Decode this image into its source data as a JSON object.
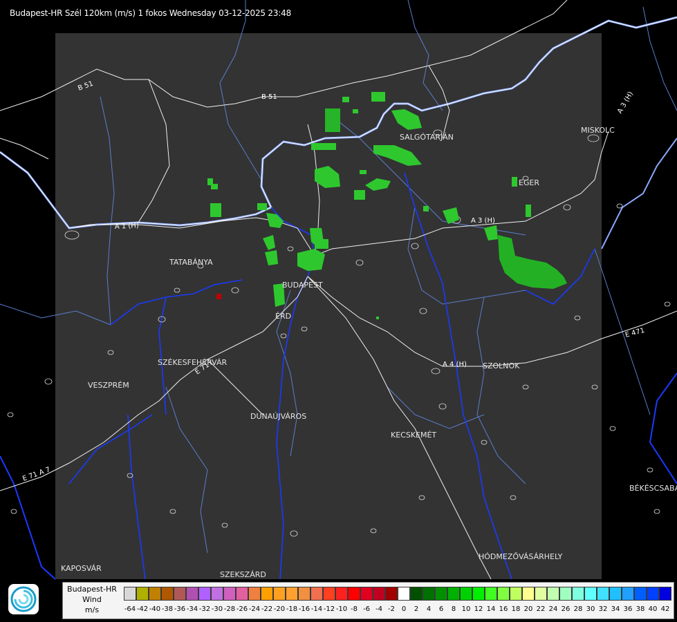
{
  "title": "Budapest-HR Szél 120km (m/s) 1 fokos Wednesday 03-12-2025 23:48",
  "cities": [
    {
      "id": "salgotarjan",
      "name": "SALGÓTARJÁN"
    },
    {
      "id": "miskolc",
      "name": "MISKOLC"
    },
    {
      "id": "eger",
      "name": "EGER"
    },
    {
      "id": "tatabanya",
      "name": "TATABÁNYA"
    },
    {
      "id": "budapest",
      "name": "BUDAPEST"
    },
    {
      "id": "erd",
      "name": "ÉRD"
    },
    {
      "id": "szekesfehervar",
      "name": "SZÉKESFEHÉRVÁR"
    },
    {
      "id": "veszprem",
      "name": "VESZPRÉM"
    },
    {
      "id": "dunaujvaros",
      "name": "DUNAÚJVÁROS"
    },
    {
      "id": "kecskemet",
      "name": "KECSKEMÉT"
    },
    {
      "id": "szolnok",
      "name": "SZOLNOK"
    },
    {
      "id": "bekescsaba",
      "name": "BÉKÉSCSABA"
    },
    {
      "id": "hodmezovasarhely",
      "name": "HÓDMEZŐVÁSÁRHELY"
    },
    {
      "id": "kaposvar",
      "name": "KAPOSVÁR"
    },
    {
      "id": "szekszard",
      "name": "SZEKSZÁRD"
    }
  ],
  "roads": [
    {
      "id": "b51-west",
      "name": "B 51"
    },
    {
      "id": "b51-east",
      "name": "B 51"
    },
    {
      "id": "a3-north",
      "name": "A 3 (H)"
    },
    {
      "id": "a3-mid",
      "name": "A 3 (H)"
    },
    {
      "id": "a1",
      "name": "A 1 (H)"
    },
    {
      "id": "a4",
      "name": "A 4 (H)"
    },
    {
      "id": "e71",
      "name": "E 71"
    },
    {
      "id": "e471",
      "name": "E 471"
    },
    {
      "id": "a1-south",
      "name": "E 71 A 7"
    }
  ],
  "legend": {
    "title_line1": "Budapest-HR",
    "title_line2": "Wind",
    "title_line3": "m/s",
    "scale": [
      {
        "value": "-64",
        "color": "#d8d8d8"
      },
      {
        "value": "-42",
        "color": "#b0b000"
      },
      {
        "value": "-40",
        "color": "#c08000"
      },
      {
        "value": "-38",
        "color": "#b05800"
      },
      {
        "value": "-36",
        "color": "#b05858"
      },
      {
        "value": "-34",
        "color": "#b050b0"
      },
      {
        "value": "-32",
        "color": "#b060ff"
      },
      {
        "value": "-30",
        "color": "#c070e0"
      },
      {
        "value": "-28",
        "color": "#d060c0"
      },
      {
        "value": "-26",
        "color": "#e060a0"
      },
      {
        "value": "-24",
        "color": "#f08040"
      },
      {
        "value": "-22",
        "color": "#ffa000"
      },
      {
        "value": "-20",
        "color": "#ffa020"
      },
      {
        "value": "-18",
        "color": "#ffa030"
      },
      {
        "value": "-16",
        "color": "#f09040"
      },
      {
        "value": "-14",
        "color": "#f07050"
      },
      {
        "value": "-12",
        "color": "#ff4020"
      },
      {
        "value": "-10",
        "color": "#ff2020"
      },
      {
        "value": "-8",
        "color": "#ff0000"
      },
      {
        "value": "-6",
        "color": "#e00020"
      },
      {
        "value": "-4",
        "color": "#c00020"
      },
      {
        "value": "-2",
        "color": "#a00000"
      },
      {
        "value": "0",
        "color": "#ffffff"
      },
      {
        "value": "2",
        "color": "#005000"
      },
      {
        "value": "4",
        "color": "#007000"
      },
      {
        "value": "6",
        "color": "#009000"
      },
      {
        "value": "8",
        "color": "#00b000"
      },
      {
        "value": "10",
        "color": "#00d000"
      },
      {
        "value": "12",
        "color": "#00f000"
      },
      {
        "value": "14",
        "color": "#40ff20"
      },
      {
        "value": "16",
        "color": "#80ff40"
      },
      {
        "value": "18",
        "color": "#c0ff60"
      },
      {
        "value": "20",
        "color": "#ffff90"
      },
      {
        "value": "22",
        "color": "#e0ffa0"
      },
      {
        "value": "24",
        "color": "#c0ffb0"
      },
      {
        "value": "26",
        "color": "#a0ffc0"
      },
      {
        "value": "28",
        "color": "#80ffe0"
      },
      {
        "value": "30",
        "color": "#60ffff"
      },
      {
        "value": "32",
        "color": "#40e0ff"
      },
      {
        "value": "34",
        "color": "#20c0ff"
      },
      {
        "value": "36",
        "color": "#20a0ff"
      },
      {
        "value": "38",
        "color": "#0060ff"
      },
      {
        "value": "40",
        "color": "#0040ff"
      },
      {
        "value": "42",
        "color": "#0000e0"
      }
    ]
  },
  "colors": {
    "background": "#000000",
    "radar_area": "#333333",
    "border": "#6a8cff",
    "rivers": "#5a7ecf",
    "roads": "#f0f0f0",
    "echo": "#2ec82e"
  }
}
